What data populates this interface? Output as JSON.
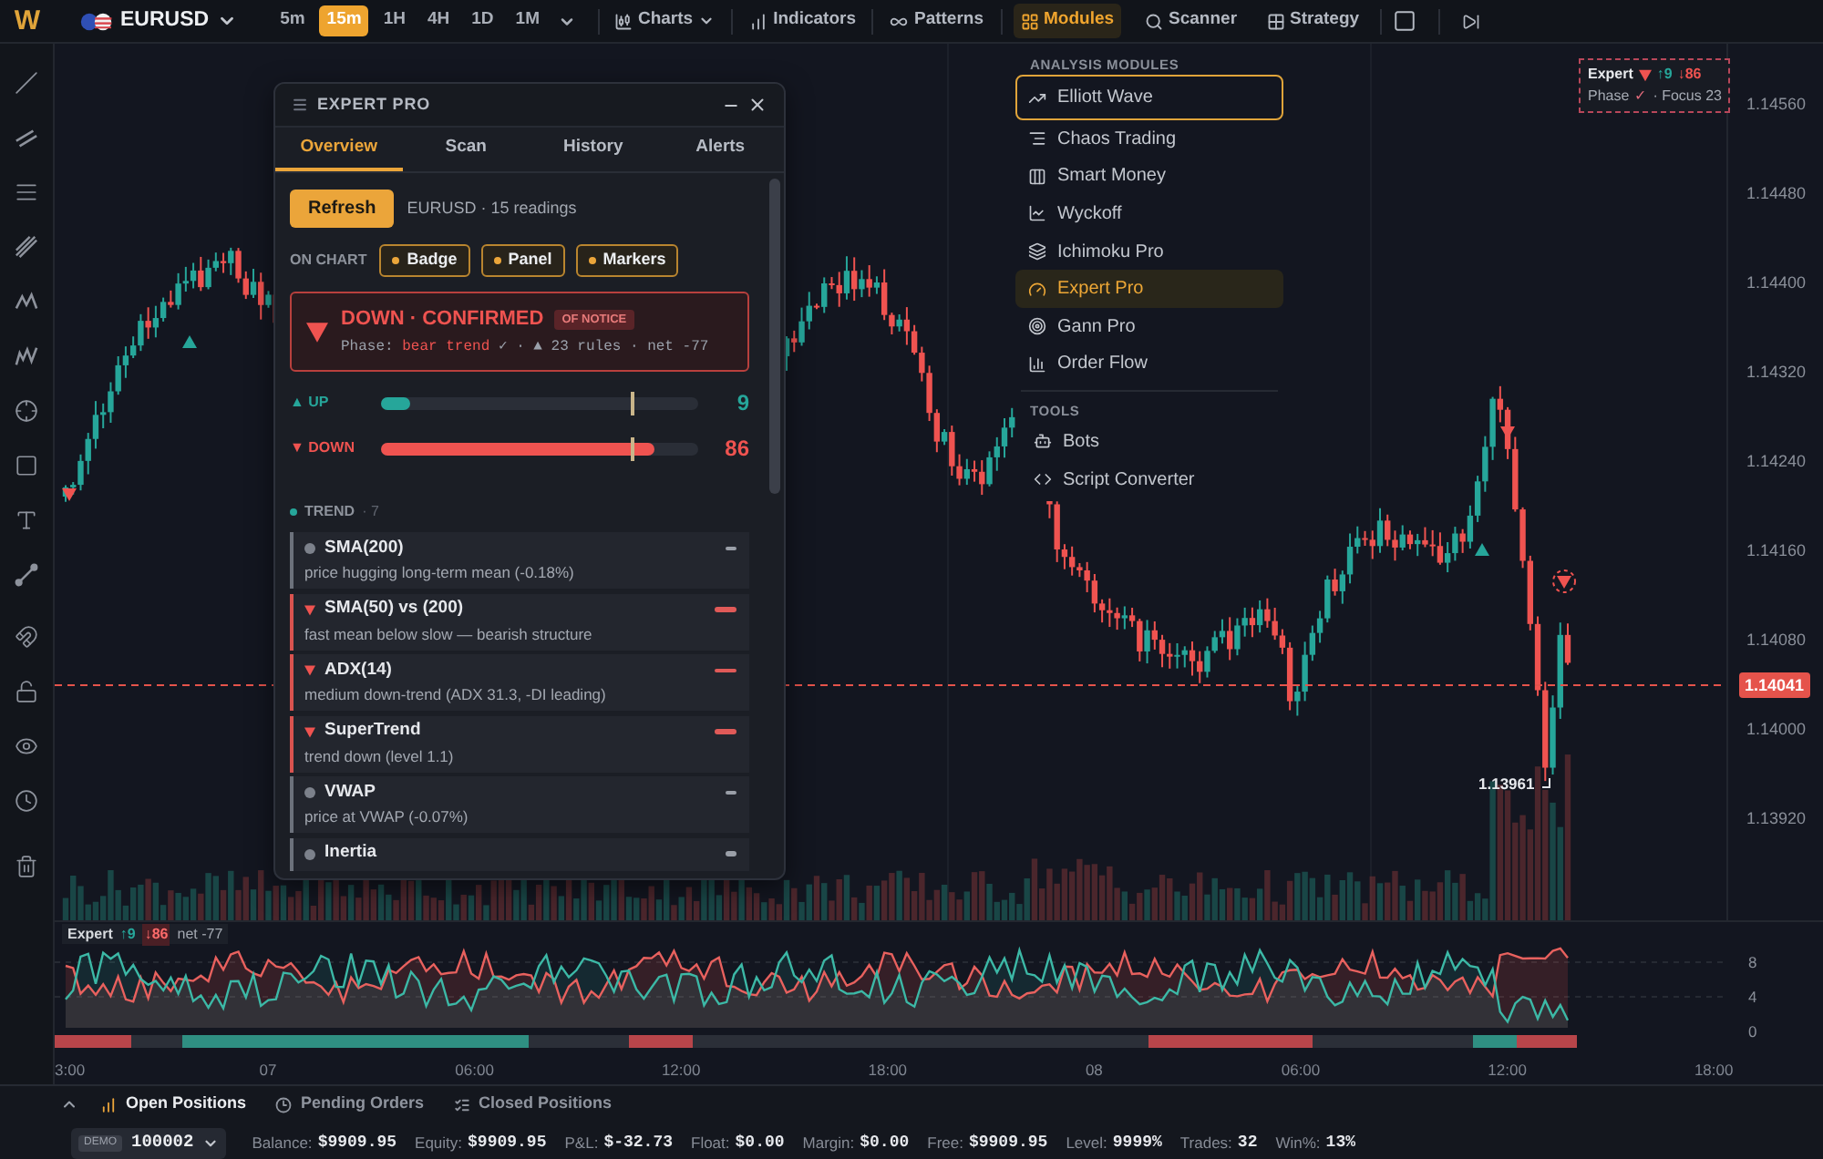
{
  "top_bar": {
    "logo": "W",
    "symbol": "EURUSD",
    "timeframes": [
      {
        "label": "5m",
        "selected": false
      },
      {
        "label": "15m",
        "selected": true
      },
      {
        "label": "1H",
        "selected": false
      },
      {
        "label": "4H",
        "selected": false
      },
      {
        "label": "1D",
        "selected": false
      },
      {
        "label": "1M",
        "selected": false
      }
    ],
    "menus": [
      {
        "label": "Charts",
        "kind": "dropdown",
        "selected": false
      },
      {
        "label": "Indicators",
        "kind": "plain",
        "selected": false
      },
      {
        "label": "Patterns",
        "kind": "plain",
        "selected": false
      },
      {
        "label": "Modules",
        "kind": "plain",
        "selected": true
      },
      {
        "label": "Scanner",
        "kind": "plain",
        "selected": false
      },
      {
        "label": "Strategy",
        "kind": "plain",
        "selected": false
      }
    ]
  },
  "modules_menu": {
    "sections": [
      {
        "title": "ANALYSIS MODULES",
        "items": [
          {
            "label": "Elliott Wave",
            "selected": false,
            "focused": true
          },
          {
            "label": "Chaos Trading",
            "selected": false,
            "focused": false
          },
          {
            "label": "Smart Money",
            "selected": false,
            "focused": false
          },
          {
            "label": "Wyckoff",
            "selected": false,
            "focused": false
          },
          {
            "label": "Ichimoku Pro",
            "selected": false,
            "focused": false
          },
          {
            "label": "Expert Pro",
            "selected": true,
            "focused": false
          },
          {
            "label": "Gann Pro",
            "selected": false,
            "focused": false
          },
          {
            "label": "Order Flow",
            "selected": false,
            "focused": false
          }
        ]
      },
      {
        "title": "TOOLS",
        "items": [
          {
            "label": "Bots",
            "selected": false,
            "focused": false
          },
          {
            "label": "Script Converter",
            "selected": false,
            "focused": false
          }
        ]
      }
    ]
  },
  "chart": {
    "price_axis": [
      "1.14560",
      "1.14480",
      "1.14400",
      "1.14320",
      "1.14240",
      "1.14160",
      "1.14080",
      "1.14000",
      "1.13920"
    ],
    "current_price": "1.14041",
    "low_label": "1.13961",
    "expert_badge": {
      "title": "Expert",
      "bearish": true,
      "up": "↑9",
      "down": "↓86",
      "phase": "Phase",
      "check": "✓",
      "focus": "· Focus 23"
    }
  },
  "expert_panel": {
    "title": "EXPERT PRO",
    "tabs": [
      {
        "label": "Overview",
        "selected": true
      },
      {
        "label": "Scan",
        "selected": false
      },
      {
        "label": "History",
        "selected": false
      },
      {
        "label": "Alerts",
        "selected": false
      }
    ],
    "refresh_button": "Refresh",
    "summary": "EURUSD · 15 readings",
    "on_chart": {
      "label": "ON CHART",
      "toggles": [
        {
          "label": "Badge",
          "on": true
        },
        {
          "label": "Panel",
          "on": true
        },
        {
          "label": "Markers",
          "on": true
        }
      ]
    },
    "verdict": {
      "bearish": true,
      "title": "DOWN · CONFIRMED",
      "badge": "OF NOTICE",
      "phase_label": "Phase:",
      "phase": "bear trend",
      "details": "✓ · ▲ 23 rules · net -77"
    },
    "scores": [
      {
        "label": "▲ UP",
        "kind": "up",
        "level": 0.09,
        "value": "9"
      },
      {
        "label": "▼ DOWN",
        "kind": "down",
        "level": 0.86,
        "value": "86"
      }
    ],
    "section": {
      "title": "TREND",
      "count": "· 7"
    },
    "rules": [
      {
        "name": "SMA(200)",
        "kind": "neutral",
        "description": "price hugging long-term mean (-0.18%)"
      },
      {
        "name": "SMA(50) vs (200)",
        "kind": "bearish",
        "description": "fast mean below slow — bearish structure"
      },
      {
        "name": "ADX(14)",
        "kind": "bearish",
        "description": "medium down-trend (ADX 31.3, -DI leading)"
      },
      {
        "name": "SuperTrend",
        "kind": "bearish",
        "description": "trend down (level 1.1)"
      },
      {
        "name": "VWAP",
        "kind": "neutral",
        "description": "price at VWAP (-0.07%)"
      },
      {
        "name": "Inertia",
        "kind": "neutral"
      }
    ]
  },
  "oscillator": {
    "legend": {
      "title": "Expert",
      "up": "↑9",
      "down": "↓86",
      "net": "net -77"
    },
    "axis": [
      "8",
      "4",
      "0"
    ]
  },
  "time_axis": [
    "3:00",
    "07",
    "06:00",
    "12:00",
    "18:00",
    "08",
    "06:00",
    "12:00",
    "18:00"
  ],
  "bottom_panel": {
    "tabs": [
      {
        "label": "Open Positions",
        "selected": true
      },
      {
        "label": "Pending Orders",
        "selected": false
      },
      {
        "label": "Closed Positions",
        "selected": false
      }
    ],
    "account": {
      "badge": "DEMO",
      "number": "100002"
    },
    "stats": [
      {
        "label": "Balance:",
        "value": "$9909.95"
      },
      {
        "label": "Equity:",
        "value": "$9909.95"
      },
      {
        "label": "P&L:",
        "value": "$-32.73"
      },
      {
        "label": "Float:",
        "value": "$0.00"
      },
      {
        "label": "Margin:",
        "value": "$0.00"
      },
      {
        "label": "Free:",
        "value": "$9909.95"
      },
      {
        "label": "Level:",
        "value": "9999%"
      },
      {
        "label": "Trades:",
        "value": "32"
      },
      {
        "label": "Win%:",
        "value": "13%"
      }
    ]
  }
}
